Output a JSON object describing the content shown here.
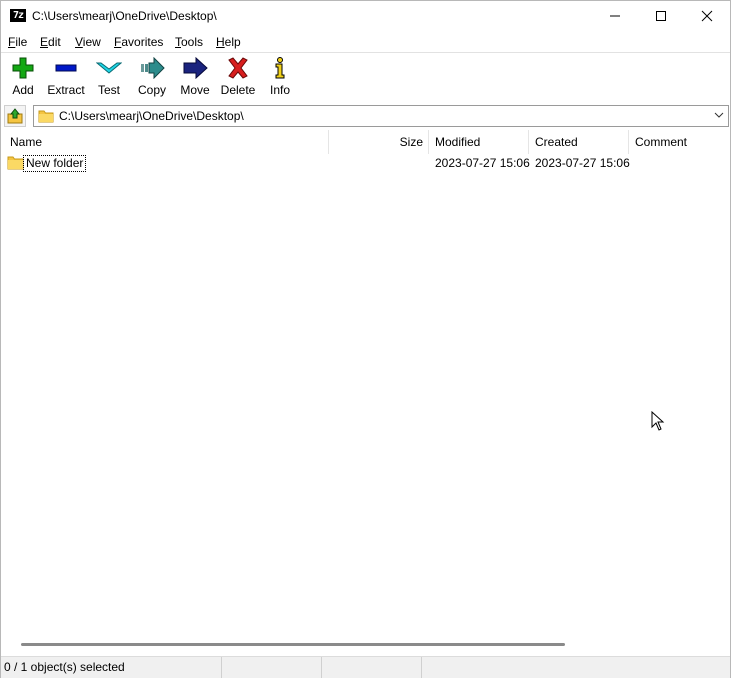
{
  "window": {
    "title": "C:\\Users\\mearj\\OneDrive\\Desktop\\",
    "app_icon_text": "7z"
  },
  "menu": [
    {
      "label": "File",
      "mnemonic": "F",
      "rest": "ile"
    },
    {
      "label": "Edit",
      "mnemonic": "E",
      "rest": "dit"
    },
    {
      "label": "View",
      "mnemonic": "V",
      "rest": "iew"
    },
    {
      "label": "Favorites",
      "mnemonic": "F",
      "rest": "avorites"
    },
    {
      "label": "Tools",
      "mnemonic": "T",
      "rest": "ools"
    },
    {
      "label": "Help",
      "mnemonic": "H",
      "rest": "elp"
    }
  ],
  "toolbar": {
    "add": "Add",
    "extract": "Extract",
    "test": "Test",
    "copy": "Copy",
    "move": "Move",
    "delete": "Delete",
    "info": "Info"
  },
  "address": {
    "path": "C:\\Users\\mearj\\OneDrive\\Desktop\\"
  },
  "columns": {
    "name": "Name",
    "size": "Size",
    "modified": "Modified",
    "created": "Created",
    "comment": "Comment"
  },
  "rows": [
    {
      "name": "New folder",
      "size": "",
      "modified": "2023-07-27 15:06",
      "created": "2023-07-27 15:06",
      "comment": ""
    }
  ],
  "status": {
    "selected": "0 / 1 object(s) selected",
    "cell2": "",
    "cell3": "",
    "cell4": ""
  },
  "colors": {
    "add_green": "#14a814",
    "extract_blue": "#0018c8",
    "test_cyan": "#1fd6e6",
    "copy_teal": "#2c8c8c",
    "move_navy": "#1a237e",
    "delete_red": "#d81e1e",
    "folder_yellow": "#f5c542"
  }
}
